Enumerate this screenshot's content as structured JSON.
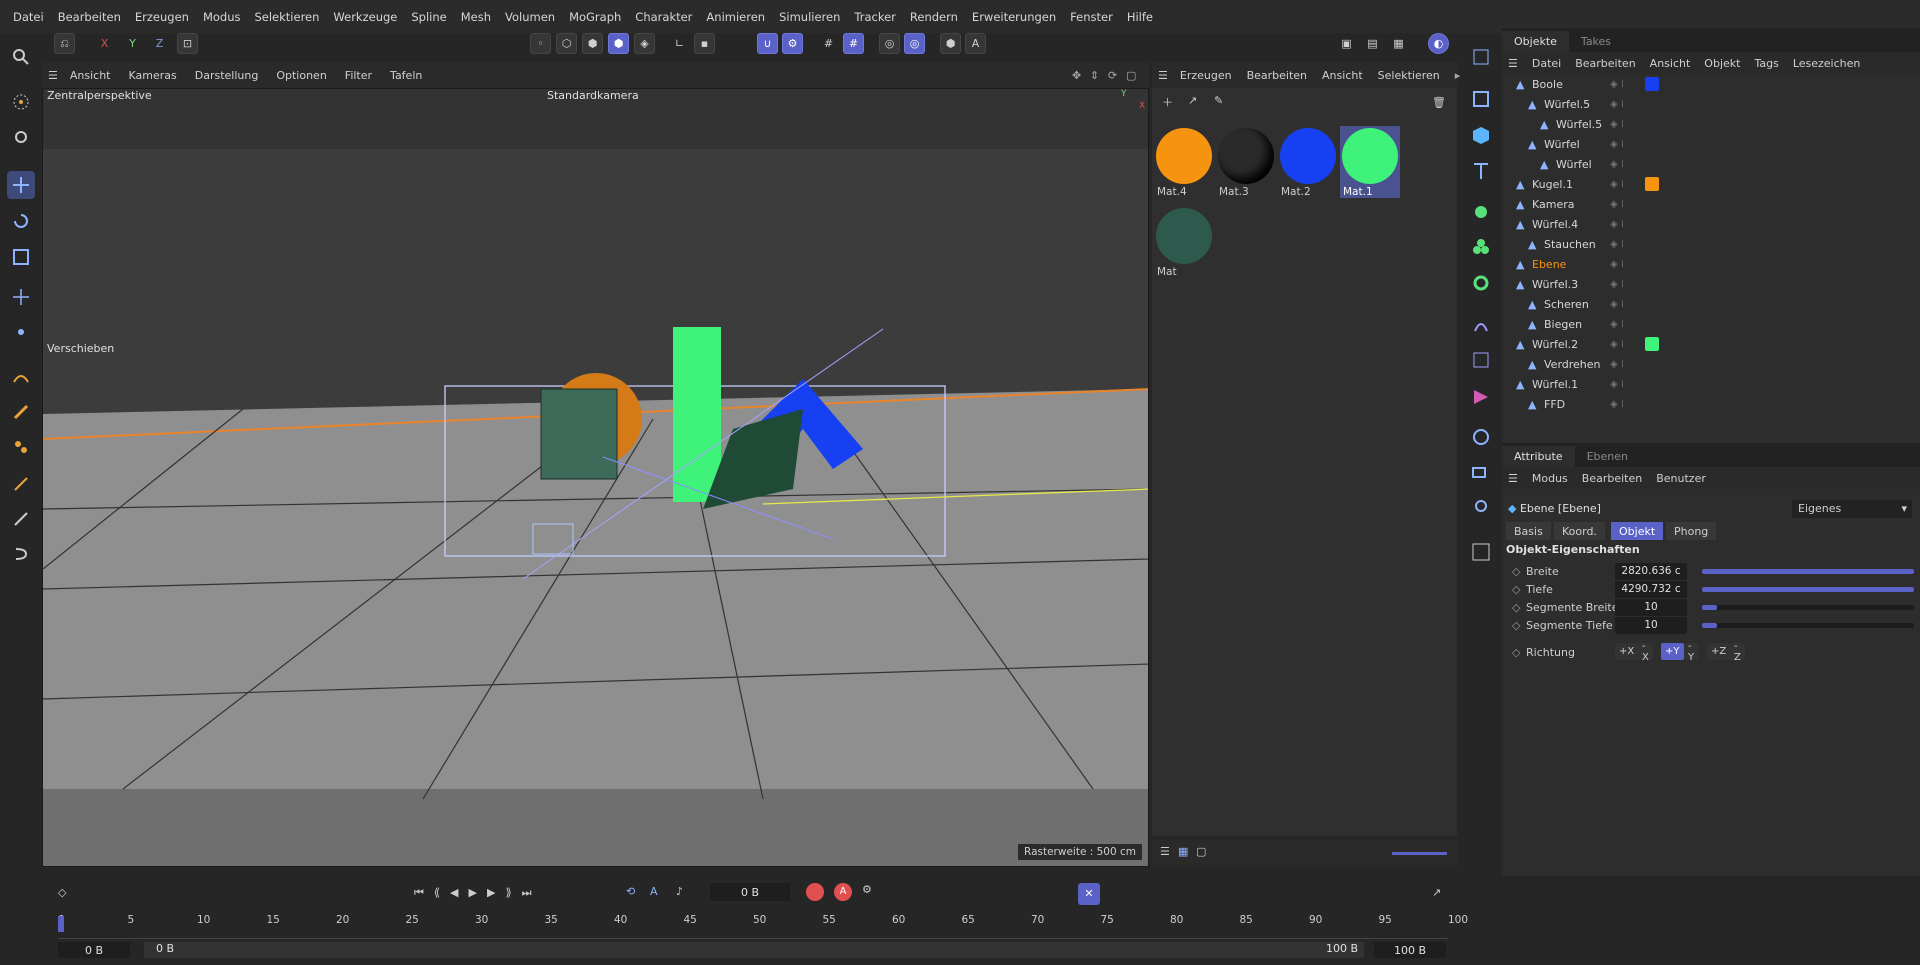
{
  "menu": [
    "Datei",
    "Bearbeiten",
    "Erzeugen",
    "Modus",
    "Selektieren",
    "Werkzeuge",
    "Spline",
    "Mesh",
    "Volumen",
    "MoGraph",
    "Charakter",
    "Animieren",
    "Simulieren",
    "Tracker",
    "Rendern",
    "Erweiterungen",
    "Fenster",
    "Hilfe"
  ],
  "axes": {
    "x": "X",
    "y": "Y",
    "z": "Z"
  },
  "viewport": {
    "menu": [
      "Ansicht",
      "Kameras",
      "Darstellung",
      "Optionen",
      "Filter",
      "Tafeln"
    ],
    "perspective": "Zentralperspektive",
    "camera": "Standardkamera",
    "tool_label": "Verschieben",
    "grid_label": "Rasterweite : 500 cm",
    "axis_y": "Y",
    "axis_x": "X"
  },
  "material_manager": {
    "menu": [
      "Erzeugen",
      "Bearbeiten",
      "Ansicht",
      "Selektieren"
    ],
    "materials": [
      {
        "name": "Mat.4",
        "color": "#f7940f"
      },
      {
        "name": "Mat.3",
        "color": "#2b2b2b"
      },
      {
        "name": "Mat.2",
        "color": "#1740f2"
      },
      {
        "name": "Mat.1",
        "color": "#3ff27a"
      },
      {
        "name": "Mat",
        "color": "#2e5a4e"
      }
    ]
  },
  "object_manager": {
    "tabs": [
      "Objekte",
      "Takes"
    ],
    "menu": [
      "Datei",
      "Bearbeiten",
      "Ansicht",
      "Objekt",
      "Tags",
      "Lesezeichen"
    ],
    "objects": [
      {
        "name": "Boole",
        "indent": 0,
        "tag_color": "#1740f2"
      },
      {
        "name": "Würfel.5",
        "indent": 1
      },
      {
        "name": "Würfel.5",
        "indent": 2
      },
      {
        "name": "Würfel",
        "indent": 1
      },
      {
        "name": "Würfel",
        "indent": 2
      },
      {
        "name": "Kugel.1",
        "indent": 0,
        "tag_color": "#f7940f"
      },
      {
        "name": "Kamera",
        "indent": 0
      },
      {
        "name": "Würfel.4",
        "indent": 0
      },
      {
        "name": "Stauchen",
        "indent": 1
      },
      {
        "name": "Ebene",
        "indent": 0,
        "highlight": true
      },
      {
        "name": "Würfel.3",
        "indent": 0
      },
      {
        "name": "Scheren",
        "indent": 1
      },
      {
        "name": "Biegen",
        "indent": 1
      },
      {
        "name": "Würfel.2",
        "indent": 0,
        "tag_color": "#3ff27a"
      },
      {
        "name": "Verdrehen",
        "indent": 1
      },
      {
        "name": "Würfel.1",
        "indent": 0
      },
      {
        "name": "FFD",
        "indent": 1
      }
    ]
  },
  "attributes": {
    "tabs": [
      "Attribute",
      "Ebenen"
    ],
    "menu": [
      "Modus",
      "Bearbeiten",
      "Benutzer"
    ],
    "object_title": "Ebene [Ebene]",
    "mode": "Eigenes",
    "subtabs": [
      "Basis",
      "Koord.",
      "Objekt",
      "Phong"
    ],
    "section": "Objekt-Eigenschaften",
    "properties": [
      {
        "label": "Breite",
        "value": "2820.636 c",
        "fill": 1.0
      },
      {
        "label": "Tiefe",
        "value": "4290.732 c",
        "fill": 1.0
      },
      {
        "label": "Segmente Breite",
        "value": "10",
        "fill": 0.07
      },
      {
        "label": "Segmente Tiefe",
        "value": "10",
        "fill": 0.07
      }
    ],
    "richtung_label": "Richtung",
    "richtung_options": [
      "+X",
      "-X",
      "+Y",
      "-Y",
      "+Z",
      "-Z"
    ],
    "richtung_selected": "+Y"
  },
  "timeline": {
    "current_frame": "0 B",
    "ticks": [
      "0",
      "5",
      "10",
      "15",
      "20",
      "25",
      "30",
      "35",
      "40",
      "45",
      "50",
      "55",
      "60",
      "65",
      "70",
      "75",
      "80",
      "85",
      "90",
      "95",
      "100"
    ],
    "start": "0 B",
    "range_start": "0 B",
    "range_end": "100 B",
    "end": "100 B"
  },
  "colors": {
    "accent": "#5a62c8",
    "orange": "#f7940f"
  }
}
